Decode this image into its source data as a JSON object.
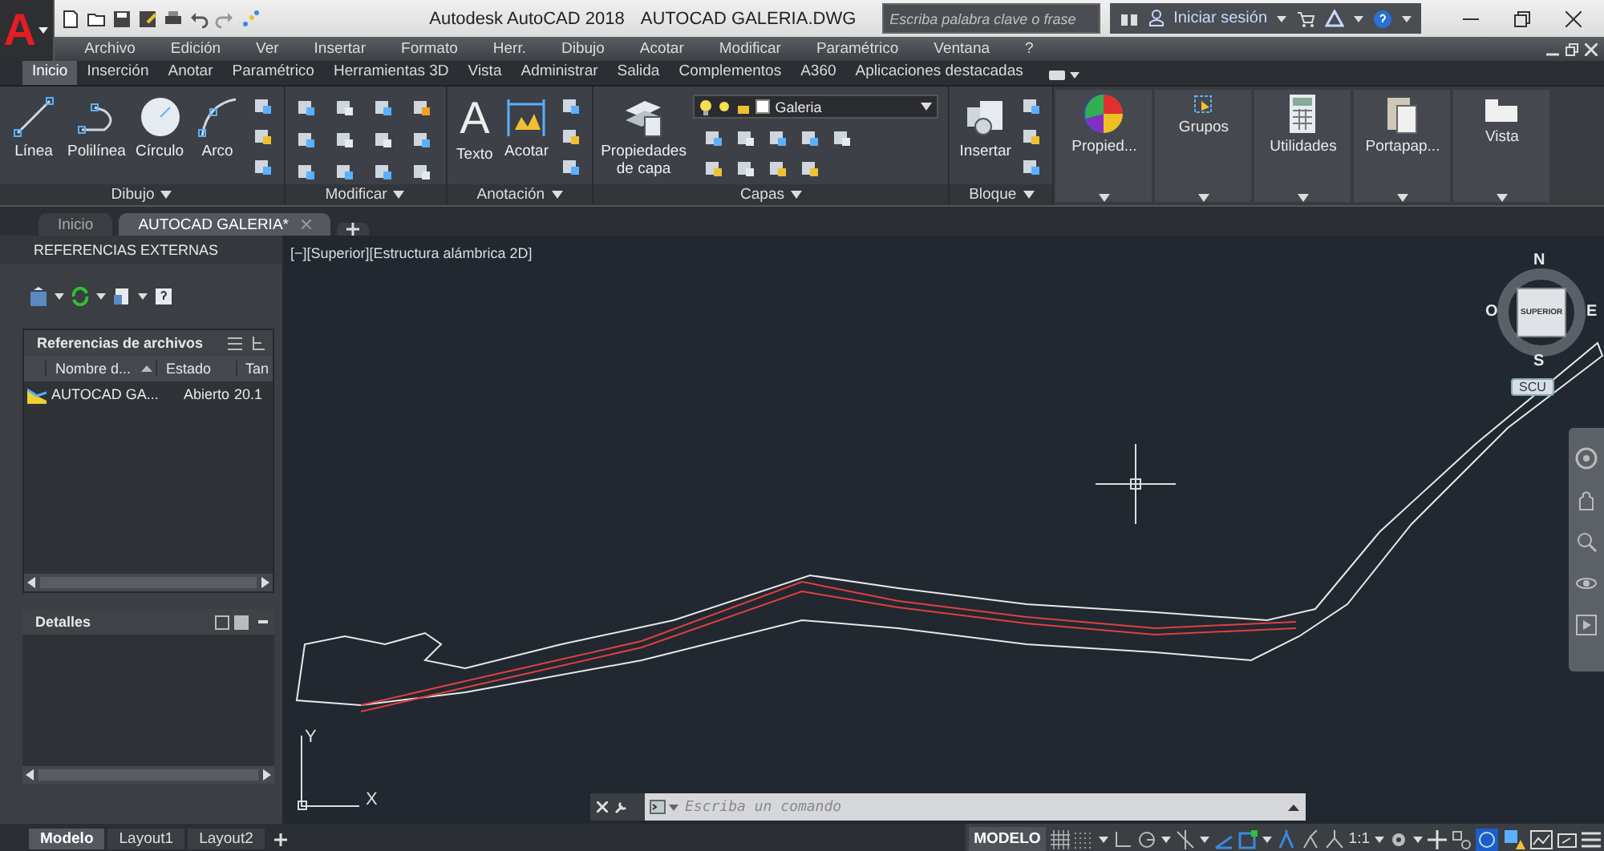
{
  "title_bar": {
    "logo": "A",
    "title": "Autodesk AutoCAD 2018",
    "file": "AUTOCAD GALERIA.DWG",
    "search": {
      "placeholder": "Escriba palabra clave o frase"
    },
    "sign_in": "Iniciar sesión"
  },
  "menu_bar": [
    "Archivo",
    "Edición",
    "Ver",
    "Insertar",
    "Formato",
    "Herr.",
    "Dibujo",
    "Acotar",
    "Modificar",
    "Paramétrico",
    "Ventana",
    "?"
  ],
  "ribbon_tabs": [
    {
      "label": "Inicio",
      "selected": true
    },
    {
      "label": "Inserción",
      "selected": false
    },
    {
      "label": "Anotar",
      "selected": false
    },
    {
      "label": "Paramétrico",
      "selected": false
    },
    {
      "label": "Herramientas 3D",
      "selected": false
    },
    {
      "label": "Vista",
      "selected": false
    },
    {
      "label": "Administrar",
      "selected": false
    },
    {
      "label": "Salida",
      "selected": false
    },
    {
      "label": "Complementos",
      "selected": false
    },
    {
      "label": "A360",
      "selected": false
    },
    {
      "label": "Aplicaciones destacadas",
      "selected": false
    }
  ],
  "ribbon_panels": [
    {
      "kind": "tools",
      "title": "Dibujo",
      "tools": [
        {
          "kind": "line",
          "label": "Línea"
        },
        {
          "kind": "polyline",
          "label": "Polilínea"
        },
        {
          "kind": "circle",
          "label": "Círculo"
        },
        {
          "kind": "arc",
          "label": "Arco"
        }
      ]
    },
    {
      "kind": "grid",
      "title": "Modificar"
    },
    {
      "kind": "tools",
      "title": "Anotación",
      "tools": [
        {
          "kind": "text",
          "label": "Texto",
          "glyph": "A"
        },
        {
          "kind": "dimension",
          "label": "Acotar"
        }
      ]
    },
    {
      "kind": "layers",
      "title": "Capas",
      "tools": [
        {
          "kind": "layers",
          "label": "Propiedades de capa"
        }
      ],
      "layer": "Galeria"
    },
    {
      "kind": "tools",
      "title": "Bloque",
      "tools": [
        {
          "kind": "insert",
          "label": "Insertar"
        }
      ]
    },
    {
      "kind": "collapsed",
      "title": "Propied..."
    },
    {
      "kind": "collapsed",
      "title": "Grupos"
    },
    {
      "kind": "collapsed",
      "title": "Utilidades"
    },
    {
      "kind": "collapsed",
      "title": "Portapap..."
    },
    {
      "kind": "collapsed",
      "title": "Vista"
    }
  ],
  "doc_tabs": [
    {
      "label": "Inicio",
      "selected": false
    },
    {
      "label": "AUTOCAD GALERIA*",
      "selected": true
    }
  ],
  "xref_palette": {
    "title": "REFERENCIAS EXTERNAS",
    "section": "Referencias de archivos",
    "columns": [
      "Nombre d...",
      "Estado",
      "Tan"
    ],
    "rows": [
      {
        "cells": [
          "AUTOCAD GA...",
          "Abierto",
          "20.1"
        ]
      }
    ],
    "details_title": "Detalles"
  },
  "viewport": {
    "label": "[−][Superior][Estructura alámbrica 2D]",
    "compass": {
      "north": "N",
      "south": "S",
      "east": "E",
      "west": "O",
      "face": "SUPERIOR"
    },
    "ucs_menu": "SCU",
    "axis_x": "X",
    "axis_y": "Y"
  },
  "command_line": {
    "placeholder": "Escriba un comando"
  },
  "layout_tabs": [
    {
      "label": "Modelo",
      "selected": true
    },
    {
      "label": "Layout1",
      "selected": false
    },
    {
      "label": "Layout2",
      "selected": false
    }
  ],
  "status_bar": {
    "space": "MODELO",
    "scale": "1:1"
  }
}
